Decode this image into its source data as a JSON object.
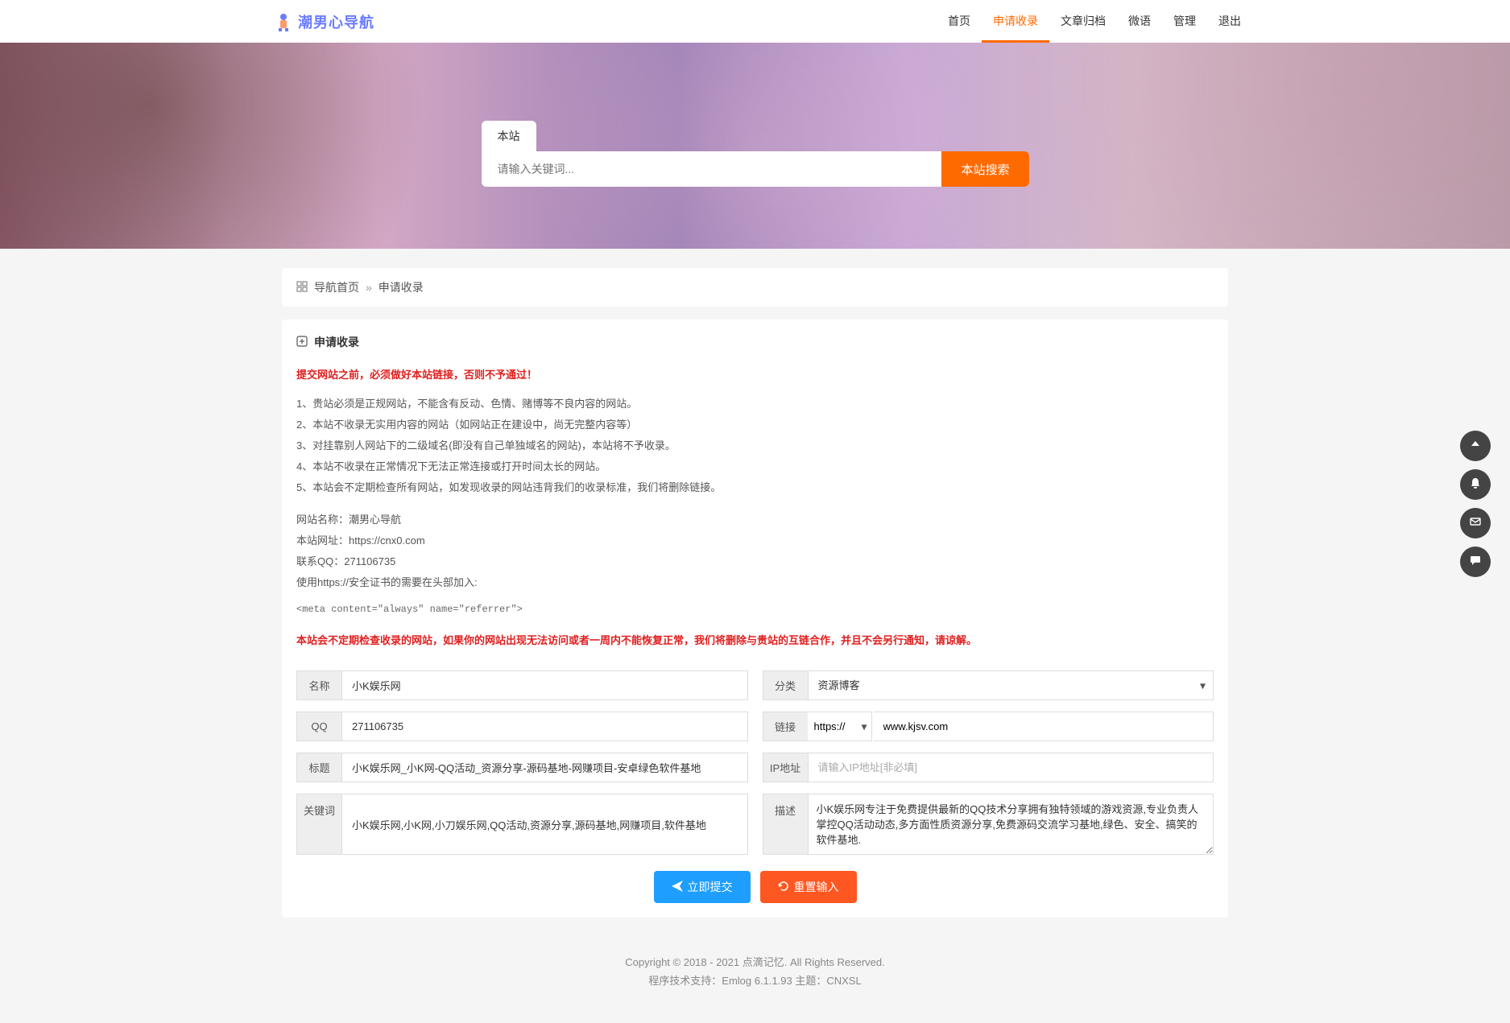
{
  "header": {
    "logo_text": "潮男心导航",
    "nav": [
      {
        "label": "首页"
      },
      {
        "label": "申请收录",
        "active": true
      },
      {
        "label": "文章归档"
      },
      {
        "label": "微语"
      },
      {
        "label": "管理"
      },
      {
        "label": "退出"
      }
    ]
  },
  "search": {
    "tab": "本站",
    "placeholder": "请输入关键词...",
    "button": "本站搜索"
  },
  "breadcrumb": {
    "home": "导航首页",
    "sep": "»",
    "current": "申请收录"
  },
  "panel": {
    "title": "申请收录",
    "warning1": "提交网站之前，必须做好本站链接，否则不予通过！",
    "rules": [
      "1、贵站必须是正规网站，不能含有反动、色情、赌博等不良内容的网站。",
      "2、本站不收录无实用内容的网站（如网站正在建设中，尚无完整内容等）",
      "3、对挂靠别人网站下的二级域名(即没有自己单独域名的网站)，本站将不予收录。",
      "4、本站不收录在正常情况下无法正常连接或打开时间太长的网站。",
      "5、本站会不定期检查所有网站，如发现收录的网站违背我们的收录标准，我们将删除链接。"
    ],
    "site_info": [
      "网站名称：潮男心导航",
      "本站网址：https://cnx0.com",
      "联系QQ：271106735",
      "使用https://安全证书的需要在头部加入:"
    ],
    "meta_code": "<meta content=\"always\" name=\"referrer\">",
    "warning2": "本站会不定期检查收录的网站，如果你的网站出现无法访问或者一周内不能恢复正常，我们将删除与贵站的互链合作，并且不会另行通知，请谅解。"
  },
  "form": {
    "name": {
      "label": "名称",
      "value": "小K娱乐网"
    },
    "qq": {
      "label": "QQ",
      "value": "271106735"
    },
    "title": {
      "label": "标题",
      "value": "小K娱乐网_小K网-QQ活动_资源分享-源码基地-网赚项目-安卓绿色软件基地"
    },
    "keywords": {
      "label": "关键词",
      "value": "小K娱乐网,小K网,小刀娱乐网,QQ活动,资源分享,源码基地,网赚项目,软件基地"
    },
    "category": {
      "label": "分类",
      "value": "资源博客"
    },
    "link": {
      "label": "链接",
      "protocol": "https://",
      "value": "www.kjsv.com"
    },
    "ip": {
      "label": "IP地址",
      "placeholder": "请输入IP地址[非必填]"
    },
    "desc": {
      "label": "描述",
      "value": "小K娱乐网专注于免费提供最新的QQ技术分享拥有独特领域的游戏资源,专业负责人掌控QQ活动动态,多方面性质资源分享,免费源码交流学习基地,绿色、安全、搞笑的软件基地."
    }
  },
  "buttons": {
    "submit": "立即提交",
    "reset": "重置输入"
  },
  "footer": {
    "copyright": "Copyright © 2018 - 2021 点滴记忆. All Rights Reserved.",
    "tech": "程序技术支持：Emlog 6.1.1.93 主题：CNXSL"
  },
  "float_icons": [
    "arrow-up",
    "bell",
    "mail",
    "chat"
  ]
}
